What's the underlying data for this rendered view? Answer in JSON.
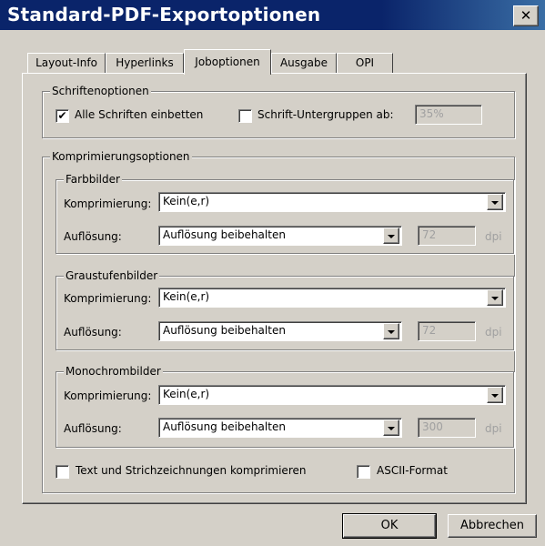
{
  "window": {
    "title": "Standard-PDF-Exportoptionen"
  },
  "tabs": [
    "Layout-Info",
    "Hyperlinks",
    "Joboptionen",
    "Ausgabe",
    "OPI"
  ],
  "fonts": {
    "legend": "Schriftenoptionen",
    "embed_all_label": "Alle Schriften einbetten",
    "embed_all_checked": "✔",
    "subset_label": "Schrift-Untergruppen ab:",
    "subset_value": "35%"
  },
  "compression": {
    "legend": "Komprimierungsoptionen",
    "compression_label": "Komprimierung:",
    "resolution_label": "Auflösung:",
    "unit": "dpi",
    "color": {
      "legend": "Farbbilder",
      "compression": "Kein(e,r)",
      "resolution": "Auflösung beibehalten",
      "dpi": "72"
    },
    "gray": {
      "legend": "Graustufenbilder",
      "compression": "Kein(e,r)",
      "resolution": "Auflösung beibehalten",
      "dpi": "72"
    },
    "mono": {
      "legend": "Monochrombilder",
      "compression": "Kein(e,r)",
      "resolution": "Auflösung beibehalten",
      "dpi": "300"
    },
    "text_label": "Text und Strichzeichnungen komprimieren",
    "ascii_label": "ASCII-Format"
  },
  "buttons": {
    "ok": "OK",
    "cancel": "Abbrechen"
  }
}
